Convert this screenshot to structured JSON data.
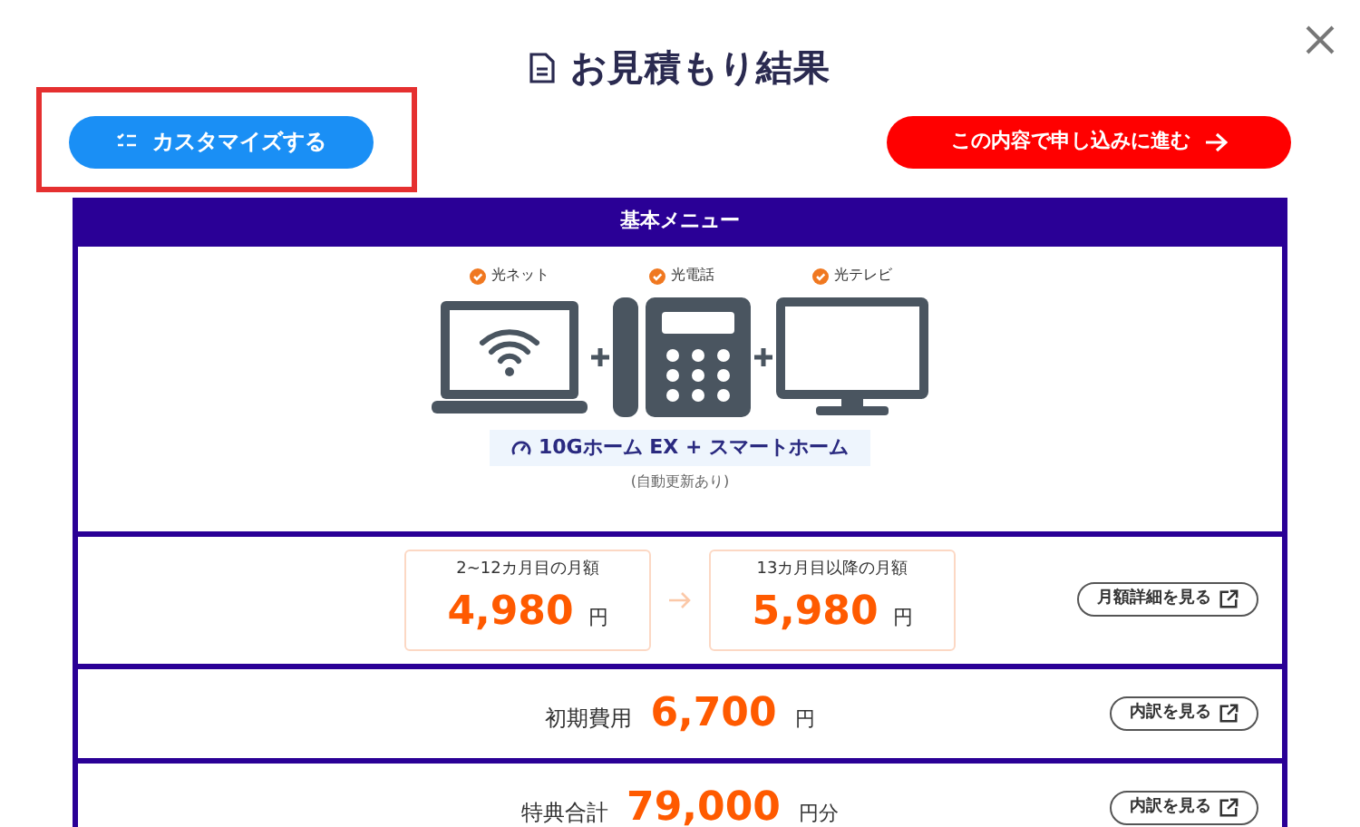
{
  "title": "お見積もり結果",
  "customize_button": {
    "label": "カスタマイズする",
    "highlighted": true
  },
  "proceed_button": {
    "label": "この内容で申し込みに進む"
  },
  "menu": {
    "header": "基本メニュー",
    "services": [
      {
        "kind": "laptop",
        "label": "光ネット"
      },
      {
        "kind": "phone",
        "label": "光電話"
      },
      {
        "kind": "tv",
        "label": "光テレビ"
      }
    ],
    "plan": "10Gホーム EX + スマートホーム",
    "note": "(自動更新あり)"
  },
  "monthly": {
    "periods": [
      {
        "label": "2~12カ月目の月額",
        "amount": "4,980",
        "unit": "円"
      },
      {
        "label": "13カ月目以降の月額",
        "amount": "5,980",
        "unit": "円"
      }
    ],
    "link": "月額詳細を見る"
  },
  "summaries": [
    {
      "label": "初期費用",
      "amount": "6,700",
      "unit": "円",
      "link": "内訳を見る"
    },
    {
      "label": "特典合計",
      "amount": "79,000",
      "unit": "円分",
      "link": "内訳を見る"
    }
  ]
}
